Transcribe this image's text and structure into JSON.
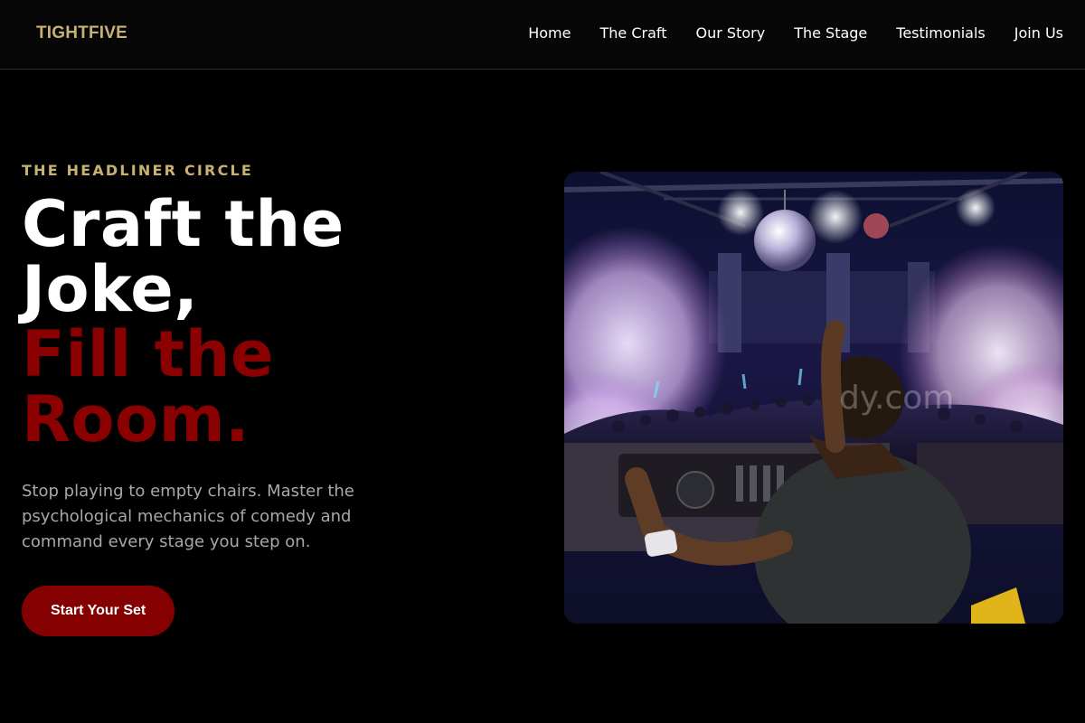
{
  "brand": {
    "name": "TIGHTFIVE"
  },
  "nav": {
    "links": [
      "Home",
      "The Craft",
      "Our Story",
      "The Stage",
      "Testimonials",
      "Join Us"
    ]
  },
  "hero": {
    "eyebrow": "THE HEADLINER CIRCLE",
    "headline": {
      "line1": "Craft the",
      "line2": "Joke,",
      "line3": "Fill the",
      "line4": "Room."
    },
    "lead": "Stop playing to empty chairs. Master the psychological mechanics of comedy and command every stage you step on.",
    "cta_label": "Start Your Set",
    "image_watermark": "dy.com"
  },
  "colors": {
    "gold": "#c8b273",
    "crimson": "#8b0000",
    "button": "#850000",
    "background": "#000000"
  }
}
